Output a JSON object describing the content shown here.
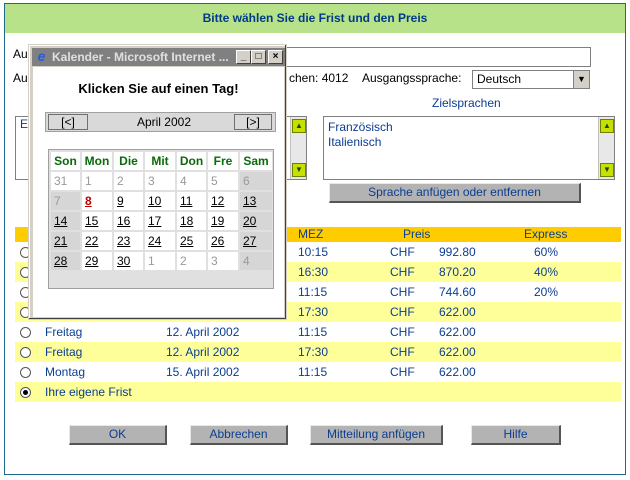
{
  "header": {
    "title": "Bitte wählen Sie die Frist und den Preis"
  },
  "form": {
    "label_row1_partial": "Au",
    "label_row2_partial": "Au",
    "word_count_label": "chen: 4012",
    "source_lang_label": "Ausgangssprache:",
    "source_lang_value": "Deutsch",
    "left_list_partial": "E",
    "target_langs_label": "Zielsprachen",
    "target_langs": [
      "Französisch",
      "Italienisch"
    ],
    "lang_button": "Sprache anfügen oder entfernen"
  },
  "table": {
    "headers": {
      "mez": "MEZ",
      "preis": "Preis",
      "express": "Express"
    },
    "rows": [
      {
        "day": "",
        "date": "",
        "time": "10:15",
        "cur": "CHF",
        "price": "992.80",
        "express": "60%",
        "selected": false
      },
      {
        "day": "",
        "date": "",
        "time": "16:30",
        "cur": "CHF",
        "price": "870.20",
        "express": "40%",
        "selected": false
      },
      {
        "day": "",
        "date": "",
        "time": "11:15",
        "cur": "CHF",
        "price": "744.60",
        "express": "20%",
        "selected": false
      },
      {
        "day": "",
        "date": "",
        "time": "17:30",
        "cur": "CHF",
        "price": "622.00",
        "express": "",
        "selected": false
      },
      {
        "day": "Freitag",
        "date": "12. April 2002",
        "time": "11:15",
        "cur": "CHF",
        "price": "622.00",
        "express": "",
        "selected": false
      },
      {
        "day": "Freitag",
        "date": "12. April 2002",
        "time": "17:30",
        "cur": "CHF",
        "price": "622.00",
        "express": "",
        "selected": false
      },
      {
        "day": "Montag",
        "date": "15. April 2002",
        "time": "11:15",
        "cur": "CHF",
        "price": "622.00",
        "express": "",
        "selected": false
      },
      {
        "day": "Ihre eigene Frist",
        "date": "",
        "time": "",
        "cur": "",
        "price": "",
        "express": "",
        "selected": true
      }
    ]
  },
  "buttons": {
    "ok": "OK",
    "cancel": "Abbrechen",
    "attach": "Mitteilung anfügen",
    "help": "Hilfe"
  },
  "popup": {
    "title": "Kalender - Microsoft Internet ...",
    "heading": "Klicken Sie auf einen Tag!",
    "prev": "[<]",
    "next": "[>]",
    "month": "April 2002",
    "weekdays": [
      "Son",
      "Mon",
      "Die",
      "Mit",
      "Don",
      "Fre",
      "Sam"
    ],
    "weeks": [
      [
        {
          "d": "31",
          "s": "other"
        },
        {
          "d": "1",
          "s": "past"
        },
        {
          "d": "2",
          "s": "past"
        },
        {
          "d": "3",
          "s": "past"
        },
        {
          "d": "4",
          "s": "past"
        },
        {
          "d": "5",
          "s": "past"
        },
        {
          "d": "6",
          "s": "past shade"
        }
      ],
      [
        {
          "d": "7",
          "s": "past shade"
        },
        {
          "d": "8",
          "s": "today"
        },
        {
          "d": "9",
          "s": "active"
        },
        {
          "d": "10",
          "s": "active"
        },
        {
          "d": "11",
          "s": "active"
        },
        {
          "d": "12",
          "s": "active"
        },
        {
          "d": "13",
          "s": "active shade"
        }
      ],
      [
        {
          "d": "14",
          "s": "active shade"
        },
        {
          "d": "15",
          "s": "active"
        },
        {
          "d": "16",
          "s": "active"
        },
        {
          "d": "17",
          "s": "active"
        },
        {
          "d": "18",
          "s": "active"
        },
        {
          "d": "19",
          "s": "active"
        },
        {
          "d": "20",
          "s": "active shade"
        }
      ],
      [
        {
          "d": "21",
          "s": "active shade"
        },
        {
          "d": "22",
          "s": "active"
        },
        {
          "d": "23",
          "s": "active"
        },
        {
          "d": "24",
          "s": "active"
        },
        {
          "d": "25",
          "s": "active"
        },
        {
          "d": "26",
          "s": "active"
        },
        {
          "d": "27",
          "s": "active shade"
        }
      ],
      [
        {
          "d": "28",
          "s": "active shade"
        },
        {
          "d": "29",
          "s": "active"
        },
        {
          "d": "30",
          "s": "active"
        },
        {
          "d": "1",
          "s": "other"
        },
        {
          "d": "2",
          "s": "other"
        },
        {
          "d": "3",
          "s": "other"
        },
        {
          "d": "4",
          "s": "other shade"
        }
      ]
    ]
  }
}
